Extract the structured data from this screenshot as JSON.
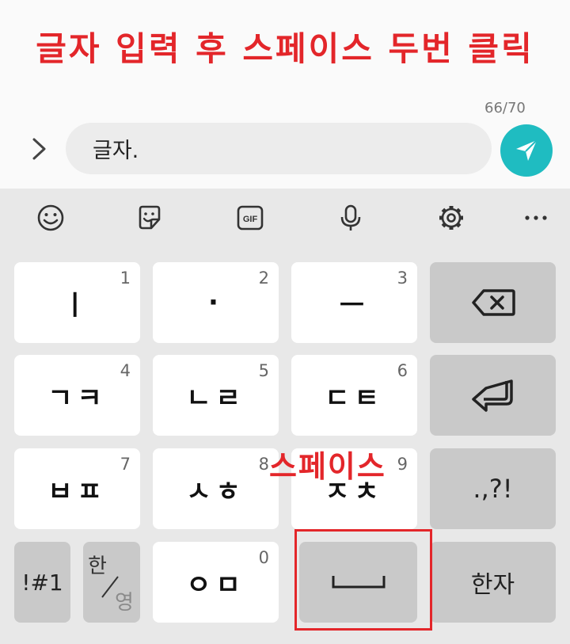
{
  "instruction": "글자 입력 후 스페이스 두번 클릭",
  "char_count": "66/70",
  "message_input": {
    "value": "글자."
  },
  "toolbar": [
    "emoji-icon",
    "sticker-icon",
    "gif-icon",
    "microphone-icon",
    "settings-icon",
    "more-icon"
  ],
  "toolbar_gif_label": "GIF",
  "keys": {
    "k1": {
      "label": "ㅣ",
      "num": "1"
    },
    "k2": {
      "label": "·",
      "num": "2"
    },
    "k3": {
      "label": "ㅡ",
      "num": "3"
    },
    "k4": {
      "label": "ㄱㅋ",
      "num": "4"
    },
    "k5": {
      "label": "ㄴㄹ",
      "num": "5"
    },
    "k6": {
      "label": "ㄷㅌ",
      "num": "6"
    },
    "k7": {
      "label": "ㅂㅍ",
      "num": "7"
    },
    "k8": {
      "label": "ㅅㅎ",
      "num": "8"
    },
    "k9": {
      "label": "ㅈㅊ",
      "num": "9"
    },
    "k0": {
      "label": "ㅇㅁ",
      "num": "0"
    },
    "punct": ".,?!",
    "symbols": "!#1",
    "lang_top": "한",
    "lang_bottom": "영",
    "hanja": "한자"
  },
  "space_annotation": "스페이스",
  "colors": {
    "accent_red": "#e3262a",
    "send_teal": "#1fbcc1"
  }
}
